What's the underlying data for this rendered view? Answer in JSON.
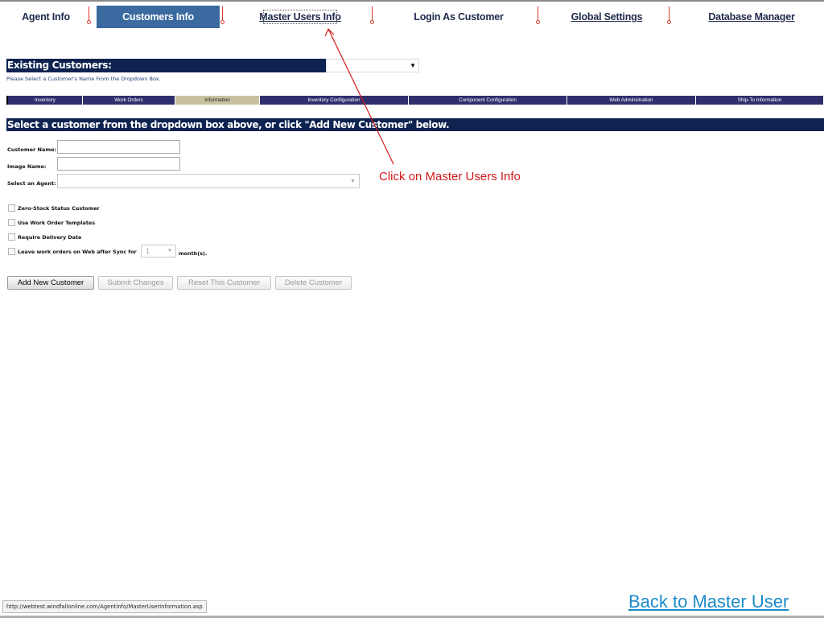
{
  "nav": {
    "items": [
      {
        "label": "Agent Info"
      },
      {
        "label": "Customers Info"
      },
      {
        "label": "Master Users Info"
      },
      {
        "label": "Login As Customer"
      },
      {
        "label": "Global Settings"
      },
      {
        "label": "Database Manager"
      }
    ],
    "active": "Customers Info"
  },
  "existing_customers": {
    "title": "Existing Customers:",
    "hint": "Please Select a Customer's Name From the Dropdown Box.",
    "selected": ""
  },
  "tabs": [
    {
      "label": "Inventory"
    },
    {
      "label": "Work Orders"
    },
    {
      "label": "Information"
    },
    {
      "label": "Inventory Configuration"
    },
    {
      "label": "Component Configuration"
    },
    {
      "label": "Web Administration"
    },
    {
      "label": "Ship-To Information"
    }
  ],
  "active_tab": "Information",
  "select_banner": "Select a customer from the dropdown box above, or click \"Add New Customer\" below.",
  "form": {
    "customer_name_label": "Customer Name:",
    "customer_name_value": "",
    "image_name_label": "Image Name:",
    "image_name_value": "",
    "agent_label": "Select an Agent:",
    "agent_value": ""
  },
  "options": {
    "zero_stock": "Zero-Stock Status Customer",
    "work_order_templates": "Use Work Order Templates",
    "require_delivery": "Require Delivery Date",
    "leave_work_orders": "Leave work orders on Web after Sync for",
    "months_value": "1",
    "months_suffix": "month(s)."
  },
  "buttons": {
    "add": "Add New Customer",
    "submit": "Submit Changes",
    "reset": "Reset This Customer",
    "delete": "Delete Customer"
  },
  "annotation": "Click on Master Users Info",
  "status_url": "http://webtest.windfallonline.com/AgentInfo/MasterUserInformation.asp",
  "back_link": "Back to Master User",
  "colors": {
    "nav_active_bg": "#3a6aa0",
    "header_bar_bg": "#0e2350",
    "tab_bg": "#2f2f6e",
    "tab_active_bg": "#c7c1a0",
    "annotation_red": "#d31a1a",
    "link_blue": "#1c8bc9"
  },
  "icons": [
    "dropdown-arrow-icon",
    "checkbox-icon",
    "annotation-arrow-icon"
  ]
}
